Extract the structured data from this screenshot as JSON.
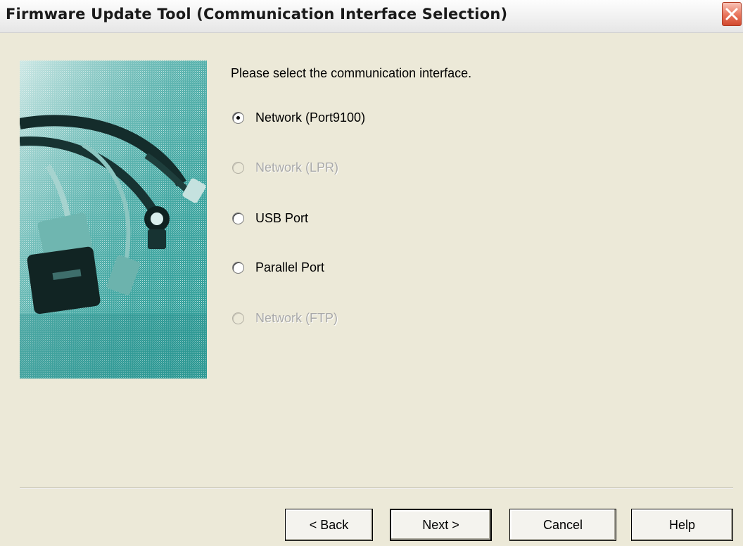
{
  "window": {
    "title": "Firmware Update Tool (Communication Interface Selection)"
  },
  "prompt": "Please select the communication interface.",
  "options": [
    {
      "label": "Network (Port9100)",
      "selected": true,
      "enabled": true
    },
    {
      "label": "Network (LPR)",
      "selected": false,
      "enabled": false
    },
    {
      "label": "USB Port",
      "selected": false,
      "enabled": true
    },
    {
      "label": "Parallel Port",
      "selected": false,
      "enabled": true
    },
    {
      "label": "Network (FTP)",
      "selected": false,
      "enabled": false
    }
  ],
  "buttons": {
    "back": "< Back",
    "next": "Next >",
    "cancel": "Cancel",
    "help": "Help"
  },
  "icons": {
    "close": "close-icon",
    "illustration": "cables-illustration"
  },
  "colors": {
    "close_red": "#E8735A",
    "illustration_teal": "#2E9C98",
    "dialog_bg": "#ECE9D8"
  }
}
